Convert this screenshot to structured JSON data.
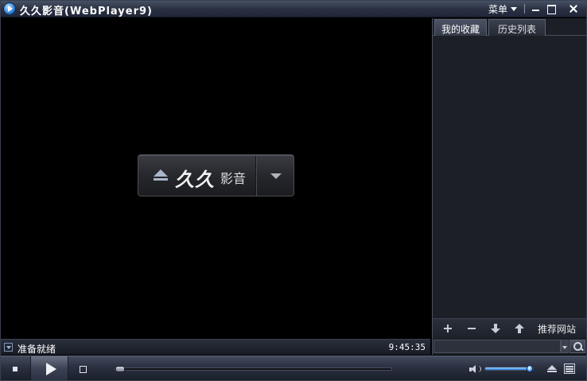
{
  "window": {
    "title": "久久影音(WebPlayer9)",
    "menu_label": "菜单"
  },
  "video": {
    "logo_main": "久久",
    "logo_sub": "影音"
  },
  "status": {
    "text": "准备就绪",
    "time": "9:45:35"
  },
  "sidepanel": {
    "tabs": [
      {
        "label": "我的收藏",
        "active": true
      },
      {
        "label": "历史列表",
        "active": false
      }
    ],
    "recommend_label": "推荐网站",
    "search_value": ""
  },
  "controls": {
    "volume_level": 0.88,
    "seek_position": 0.0
  },
  "colors": {
    "titlebar": "#2a3142",
    "panel_bg": "#1c1f26",
    "video_bg": "#000000",
    "volume_accent": "#2a7fe0"
  }
}
